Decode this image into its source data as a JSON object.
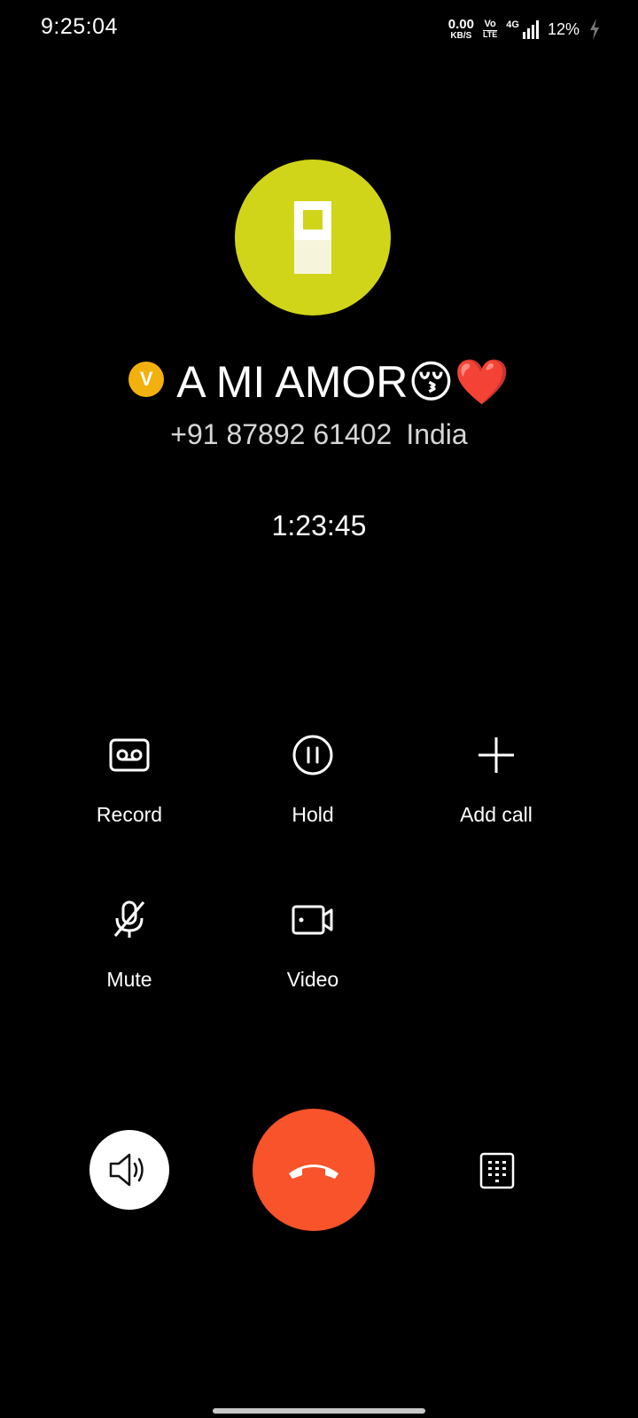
{
  "status_bar": {
    "time": "9:25:04",
    "net_speed_value": "0.00",
    "net_speed_unit": "KB/S",
    "volte_top": "Vo",
    "volte_bottom": "LTE",
    "network_type": "4G",
    "battery_percent": "12%",
    "charging": true
  },
  "contact": {
    "badge_letter": "V",
    "name": "A MI AMOR😚❤️",
    "phone": "+91 87892 61402",
    "location": "India",
    "avatar_color": "#d1d519"
  },
  "call": {
    "timer": "1:23:45"
  },
  "actions": [
    {
      "label": "Record",
      "icon": "record-icon"
    },
    {
      "label": "Hold",
      "icon": "pause-icon"
    },
    {
      "label": "Add call",
      "icon": "plus-icon"
    },
    {
      "label": "Mute",
      "icon": "mic-off-icon"
    },
    {
      "label": "Video",
      "icon": "video-camera-icon"
    }
  ],
  "bottom_controls": {
    "speaker_icon": "speaker-icon",
    "end_call_icon": "phone-hangup-icon",
    "keypad_icon": "dialpad-icon",
    "end_call_color": "#f8532a"
  }
}
